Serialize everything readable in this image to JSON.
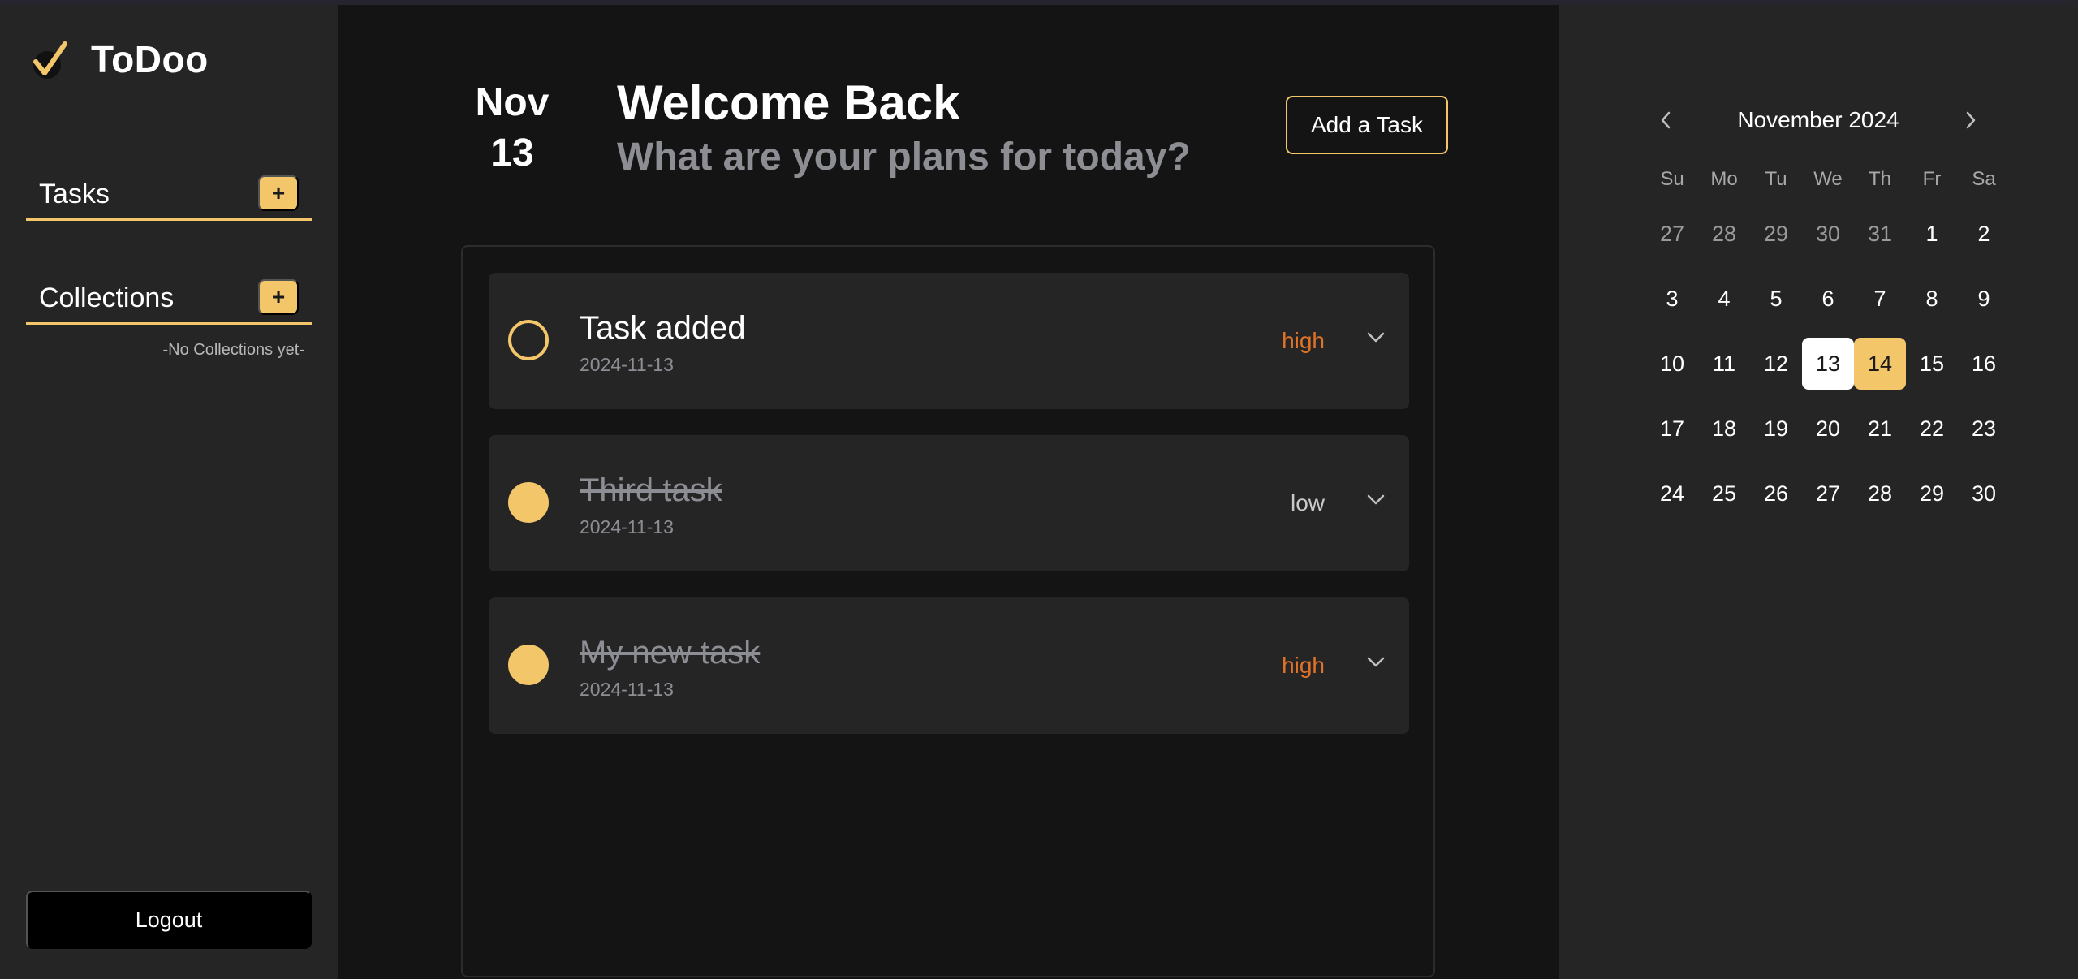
{
  "app": {
    "name": "ToDoo"
  },
  "colors": {
    "accent": "#f3c66a",
    "high": "#e07328",
    "low": "#c9c9c9",
    "sidebar": "#252525",
    "main": "#141414"
  },
  "sidebar": {
    "tasks_label": "Tasks",
    "collections_label": "Collections",
    "plus_label": "+",
    "no_collections": "-No Collections yet-",
    "logout_label": "Logout"
  },
  "header": {
    "month": "Nov",
    "day": "13",
    "welcome": "Welcome Back",
    "subtitle": "What are your plans for today?",
    "add_task_label": "Add a Task"
  },
  "tasks": [
    {
      "title": "Task added",
      "date": "2024-11-13",
      "priority": "high",
      "completed": false
    },
    {
      "title": "Third task",
      "date": "2024-11-13",
      "priority": "low",
      "completed": true
    },
    {
      "title": "My new task",
      "date": "2024-11-13",
      "priority": "high",
      "completed": true
    }
  ],
  "calendar": {
    "title": "November 2024",
    "weekdays": [
      "Su",
      "Mo",
      "Tu",
      "We",
      "Th",
      "Fr",
      "Sa"
    ],
    "weeks": [
      [
        {
          "d": "27",
          "m": true
        },
        {
          "d": "28",
          "m": true
        },
        {
          "d": "29",
          "m": true
        },
        {
          "d": "30",
          "m": true
        },
        {
          "d": "31",
          "m": true
        },
        {
          "d": "1"
        },
        {
          "d": "2"
        }
      ],
      [
        {
          "d": "3"
        },
        {
          "d": "4"
        },
        {
          "d": "5"
        },
        {
          "d": "6"
        },
        {
          "d": "7"
        },
        {
          "d": "8"
        },
        {
          "d": "9"
        }
      ],
      [
        {
          "d": "10"
        },
        {
          "d": "11"
        },
        {
          "d": "12"
        },
        {
          "d": "13",
          "today": true
        },
        {
          "d": "14",
          "selected": true
        },
        {
          "d": "15"
        },
        {
          "d": "16"
        }
      ],
      [
        {
          "d": "17"
        },
        {
          "d": "18"
        },
        {
          "d": "19"
        },
        {
          "d": "20"
        },
        {
          "d": "21"
        },
        {
          "d": "22"
        },
        {
          "d": "23"
        }
      ],
      [
        {
          "d": "24"
        },
        {
          "d": "25"
        },
        {
          "d": "26"
        },
        {
          "d": "27"
        },
        {
          "d": "28"
        },
        {
          "d": "29"
        },
        {
          "d": "30"
        }
      ]
    ]
  }
}
